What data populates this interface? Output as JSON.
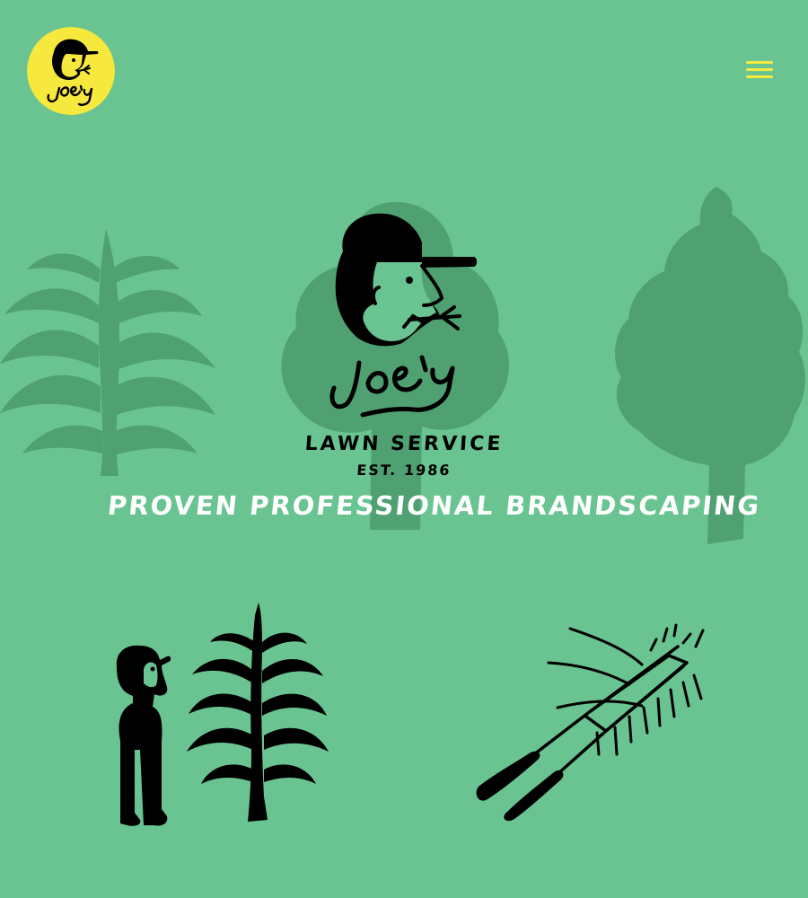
{
  "colors": {
    "background": "#69c491",
    "shadow_green": "#4fa172",
    "badge_yellow": "#f7e83e",
    "ink": "#000000",
    "tagline_white": "#ffffff",
    "menu_yellow": "#f7e83e"
  },
  "header": {
    "logo_icon": "joes-face-logo",
    "logo_wordmark": "Joe's",
    "menu_icon": "hamburger-menu-icon"
  },
  "hero": {
    "icon": "joes-face-logo",
    "wordmark": "Joe's",
    "service_name": "Lawn Service",
    "established": "Est. 1986",
    "tagline": "Proven professional Brandscaping"
  },
  "illustrations": {
    "left": "man-looking-at-tree-icon",
    "right": "hedge-shears-icon",
    "background": [
      "palm-tree-silhouette-icon",
      "round-tree-silhouette-icon",
      "pine-tree-silhouette-icon"
    ]
  }
}
